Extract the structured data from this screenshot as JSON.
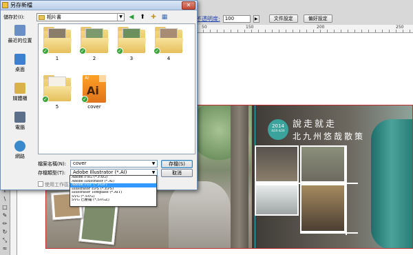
{
  "illustrator": {
    "options_bar": {
      "opacity_label": "不透明度:",
      "opacity_value": "100",
      "doc_setup_button": "文件設定",
      "preferences_button": "偏好設定"
    },
    "ruler_marks": [
      "50",
      "150",
      "200",
      "250"
    ],
    "design": {
      "badge_year": "2014",
      "badge_dates": "4/20-4/24",
      "title_line1": "說走就走",
      "title_line2": "北九州悠哉散策"
    }
  },
  "dialog": {
    "title": "另存新檔",
    "close_glyph": "✕",
    "save_in_label": "儲存於(I):",
    "current_folder": "相片書",
    "places": [
      {
        "label": "最近的位置",
        "icon": "recent-places-icon",
        "color": "#6a8fc4"
      },
      {
        "label": "桌面",
        "icon": "desktop-icon",
        "color": "#3f7fd0"
      },
      {
        "label": "媒體櫃",
        "icon": "libraries-icon",
        "color": "#d9b24a"
      },
      {
        "label": "電腦",
        "icon": "computer-icon",
        "color": "#5b6f8a"
      },
      {
        "label": "網路",
        "icon": "network-icon",
        "color": "#3a8acb"
      }
    ],
    "files": [
      {
        "name": "1",
        "type": "folder",
        "photo": "#8a7d6a"
      },
      {
        "name": "2",
        "type": "folder",
        "photo": "#7c9a6b"
      },
      {
        "name": "3",
        "type": "folder",
        "photo": "#6c8f5e"
      },
      {
        "name": "4",
        "type": "folder",
        "photo": "#a88b73"
      },
      {
        "name": "5",
        "type": "folder",
        "photo": "#f6f1e6"
      },
      {
        "name": "cover",
        "type": "ai"
      }
    ],
    "ai_icon_small": "AI",
    "ai_icon_big": "Ai",
    "filename_label": "檔案名稱(N):",
    "filename_value": "cover",
    "filetype_label": "存檔類型(T):",
    "filetype_value": "Adobe Illustrator (*.AI)",
    "save_button": "存檔(S)",
    "cancel_button": "取消",
    "artboards_checkbox_label": "使用工作區域供",
    "filetype_options": [
      "Adobe FXG (*.FXG)",
      "Adobe Illustrator (*.AI)",
      "Adobe PDF (*.PDF)",
      "Illustrator EPS (*.EPS)",
      "Illustrator Template (*.AIT)",
      "SVG (*.SVG)",
      "SVG 已壓縮 (*.SVGZ)"
    ],
    "selected_option_index": 2
  }
}
